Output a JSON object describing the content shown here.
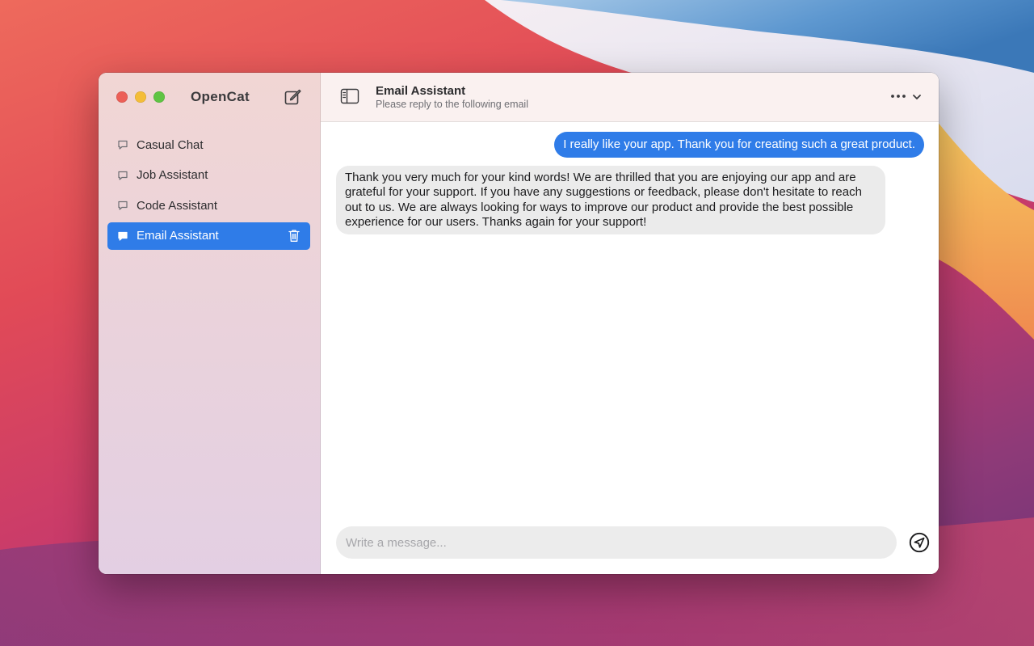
{
  "app": {
    "title": "OpenCat"
  },
  "window_controls": {
    "close_color": "#ec5f57",
    "minimize_color": "#f4bd38",
    "zoom_color": "#5fc443"
  },
  "sidebar": {
    "compose_icon": "compose-icon",
    "items": [
      {
        "label": "Casual Chat",
        "icon": "chat-bubble-icon",
        "active": false
      },
      {
        "label": "Job Assistant",
        "icon": "chat-bubble-icon",
        "active": false
      },
      {
        "label": "Code Assistant",
        "icon": "chat-bubble-icon",
        "active": false
      },
      {
        "label": "Email Assistant",
        "icon": "chat-bubble-icon",
        "active": true,
        "action_icon": "trash-icon"
      }
    ]
  },
  "header": {
    "title": "Email Assistant",
    "subtitle": "Please reply to the following email",
    "toggle_icon": "sidebar-toggle-icon",
    "more_icon": "ellipsis-icon",
    "menu_icon": "chevron-down-icon"
  },
  "messages": [
    {
      "role": "user",
      "text": "I really like your app. Thank you for creating such a great product."
    },
    {
      "role": "assistant",
      "text": "Thank you very much for your kind words! We are thrilled that you are enjoying our app and are grateful for your support. If you have any suggestions or feedback, please don't hesitate to reach out to us. We are always looking for ways to improve our product and provide the best possible experience for our users. Thanks again for your support!"
    }
  ],
  "composer": {
    "value": "",
    "placeholder": "Write a message...",
    "send_icon": "send-icon"
  },
  "colors": {
    "accent": "#2f7ce8",
    "assistant_bubble": "#ebebeb",
    "topbar": "#faf1f0"
  }
}
